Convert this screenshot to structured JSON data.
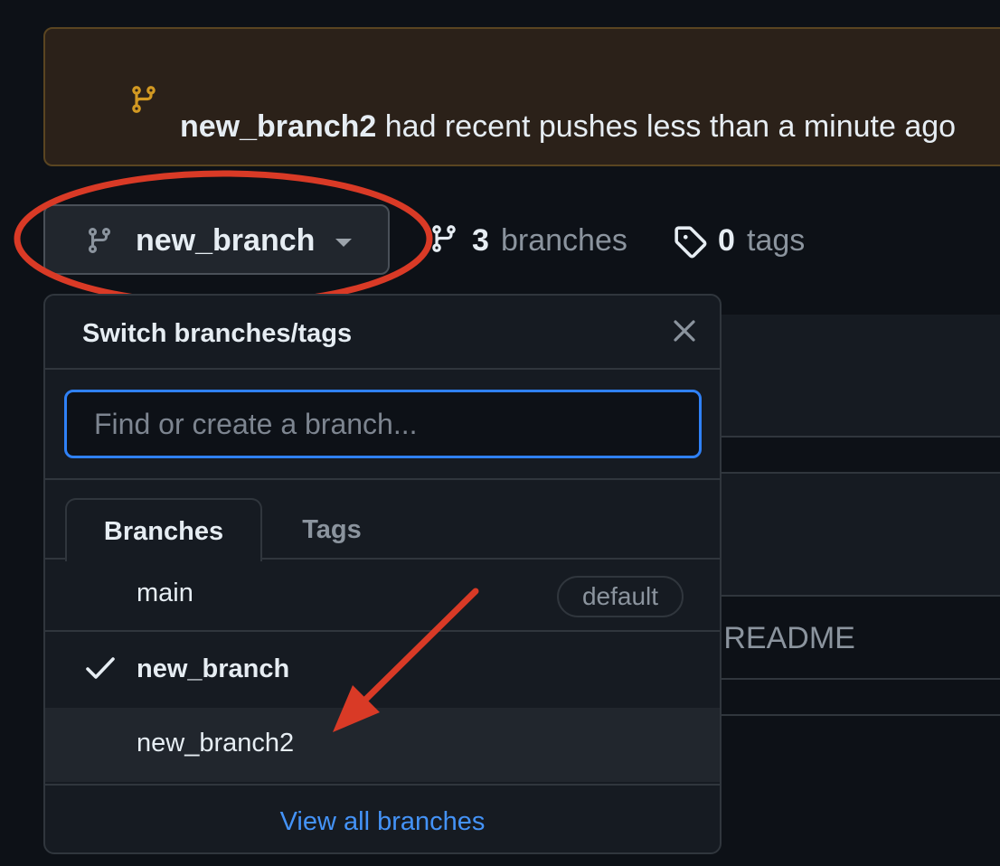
{
  "banner": {
    "branch_name": "new_branch2",
    "message": " had recent pushes less than a minute ago",
    "accent_color": "#d29922"
  },
  "branch_selector": {
    "current_branch": "new_branch",
    "icon": "git-branch-icon"
  },
  "counts": {
    "branches_count": "3",
    "branches_label": "branches",
    "tags_count": "0",
    "tags_label": "tags"
  },
  "background": {
    "readme_fragment": "e README"
  },
  "dropdown": {
    "title": "Switch branches/tags",
    "search_placeholder": "Find or create a branch...",
    "tabs": [
      {
        "label": "Branches",
        "selected": true
      },
      {
        "label": "Tags",
        "selected": false
      }
    ],
    "branches": [
      {
        "name": "main",
        "badge": "default",
        "checked": false
      },
      {
        "name": "new_branch",
        "badge": "",
        "checked": true
      },
      {
        "name": "new_branch2",
        "badge": "",
        "checked": false,
        "hovered": true
      }
    ],
    "view_all_label": "View all branches"
  },
  "annotations": {
    "color": "#d93a26",
    "ellipse_target": "branch_selector",
    "arrow_target": "new_branch2"
  }
}
